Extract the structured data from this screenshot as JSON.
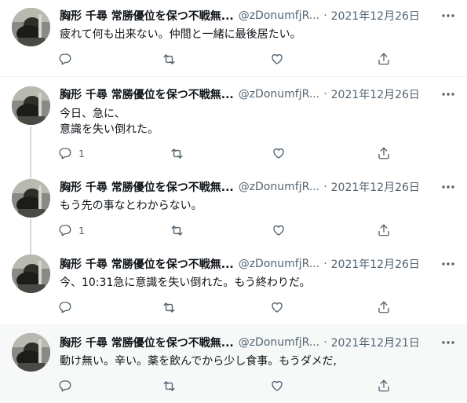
{
  "tweets": [
    {
      "name": "胸形 千尋 常勝優位を保つ不戦無...",
      "handle": "@zDonumfjR...",
      "separator": "·",
      "date": "2021年12月26日",
      "lines": [
        "疲れて何も出来ない。仲間と一緒に最後居たい。"
      ],
      "reply_count": ""
    },
    {
      "name": "胸形 千尋 常勝優位を保つ不戦無...",
      "handle": "@zDonumfjR...",
      "separator": "·",
      "date": "2021年12月26日",
      "lines": [
        "今日、急に、",
        "意識を失い倒れた。"
      ],
      "reply_count": "1"
    },
    {
      "name": "胸形 千尋 常勝優位を保つ不戦無...",
      "handle": "@zDonumfjR...",
      "separator": "·",
      "date": "2021年12月26日",
      "lines": [
        "もう先の事なとわからない。"
      ],
      "reply_count": "1"
    },
    {
      "name": "胸形 千尋 常勝優位を保つ不戦無...",
      "handle": "@zDonumfjR...",
      "separator": "·",
      "date": "2021年12月26日",
      "lines": [
        "今、10:31急に意識を失い倒れた。もう終わりだ。"
      ],
      "reply_count": ""
    },
    {
      "name": "胸形 千尋 常勝優位を保つ不戦無...",
      "handle": "@zDonumfjR...",
      "separator": "·",
      "date": "2021年12月21日",
      "lines": [
        "動け無い。辛い。薬を飲んでから少し食事。もうダメだ,"
      ],
      "reply_count": ""
    }
  ],
  "icons": {
    "more": "more-icon",
    "reply": "reply-icon",
    "retweet": "retweet-icon",
    "like": "like-icon",
    "share": "share-icon"
  },
  "colors": {
    "text": "#0f1419",
    "secondary": "#536471",
    "thread_line": "#cfd9de",
    "highlight_bg": "#f7f9f9"
  }
}
